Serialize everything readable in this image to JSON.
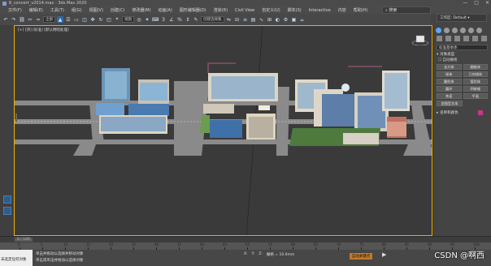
{
  "window": {
    "title": "8_convert_v2014.max - 3ds Max 2020",
    "controls": [
      "—",
      "□",
      "✕"
    ]
  },
  "menu": {
    "items": [
      "文件(F)",
      "编辑(E)",
      "工具(T)",
      "组(G)",
      "视图(V)",
      "创建(C)",
      "修改器(M)",
      "动画(A)",
      "图形编辑器(D)",
      "渲染(R)",
      "Civil View",
      "自定义(U)",
      "脚本(S)",
      "Interactive",
      "内容",
      "帮助(H)"
    ]
  },
  "search": {
    "placeholder": "搜索"
  },
  "toolbar": {
    "selection_filter": "全部",
    "view_dropdown": "视图",
    "named_set": "创建选择集"
  },
  "workspace": {
    "label": "工作区: Default ▾"
  },
  "viewport": {
    "label": "[+] [顶] [标准] [默认明暗处理]",
    "cube_label": "上"
  },
  "right_panel": {
    "tabs": [
      "create",
      "modify",
      "hierarchy",
      "motion",
      "display",
      "utilities"
    ],
    "category": "标准基本体",
    "rollout_object_type": "对象类型",
    "autogrid": "自动栅格",
    "buttons": [
      "长方体",
      "圆锥体",
      "球体",
      "几何球体",
      "圆柱体",
      "管状体",
      "圆环",
      "四棱锥",
      "茶壶",
      "平面",
      "加强型文本"
    ],
    "rollout_name_color": "名称和颜色",
    "accent_color": "#c03a8a"
  },
  "timeline": {
    "frame_display": "0 / 100"
  },
  "ruler": {
    "ticks": [
      0,
      5,
      10,
      15,
      20,
      25,
      30,
      35,
      40,
      45,
      50,
      55,
      60,
      65,
      70,
      75,
      80,
      85,
      90,
      95,
      100
    ]
  },
  "status": {
    "left_label": "未选定任何对象",
    "line1": "单击并拖动以选择并移动对象",
    "line2": "单击或单击并拖动以选择对象",
    "coords": {
      "x": "X: ",
      "y": "Y: ",
      "z": "Z: ",
      "grid": "栅格 = 10.0mm"
    },
    "add_time_tag": "添加时间标记",
    "autokey": "自动关键点",
    "selected": "选定对象",
    "setkey": "设置关键点",
    "keyfilters": "关键点过滤器..."
  },
  "watermark": "CSDN @啊西"
}
